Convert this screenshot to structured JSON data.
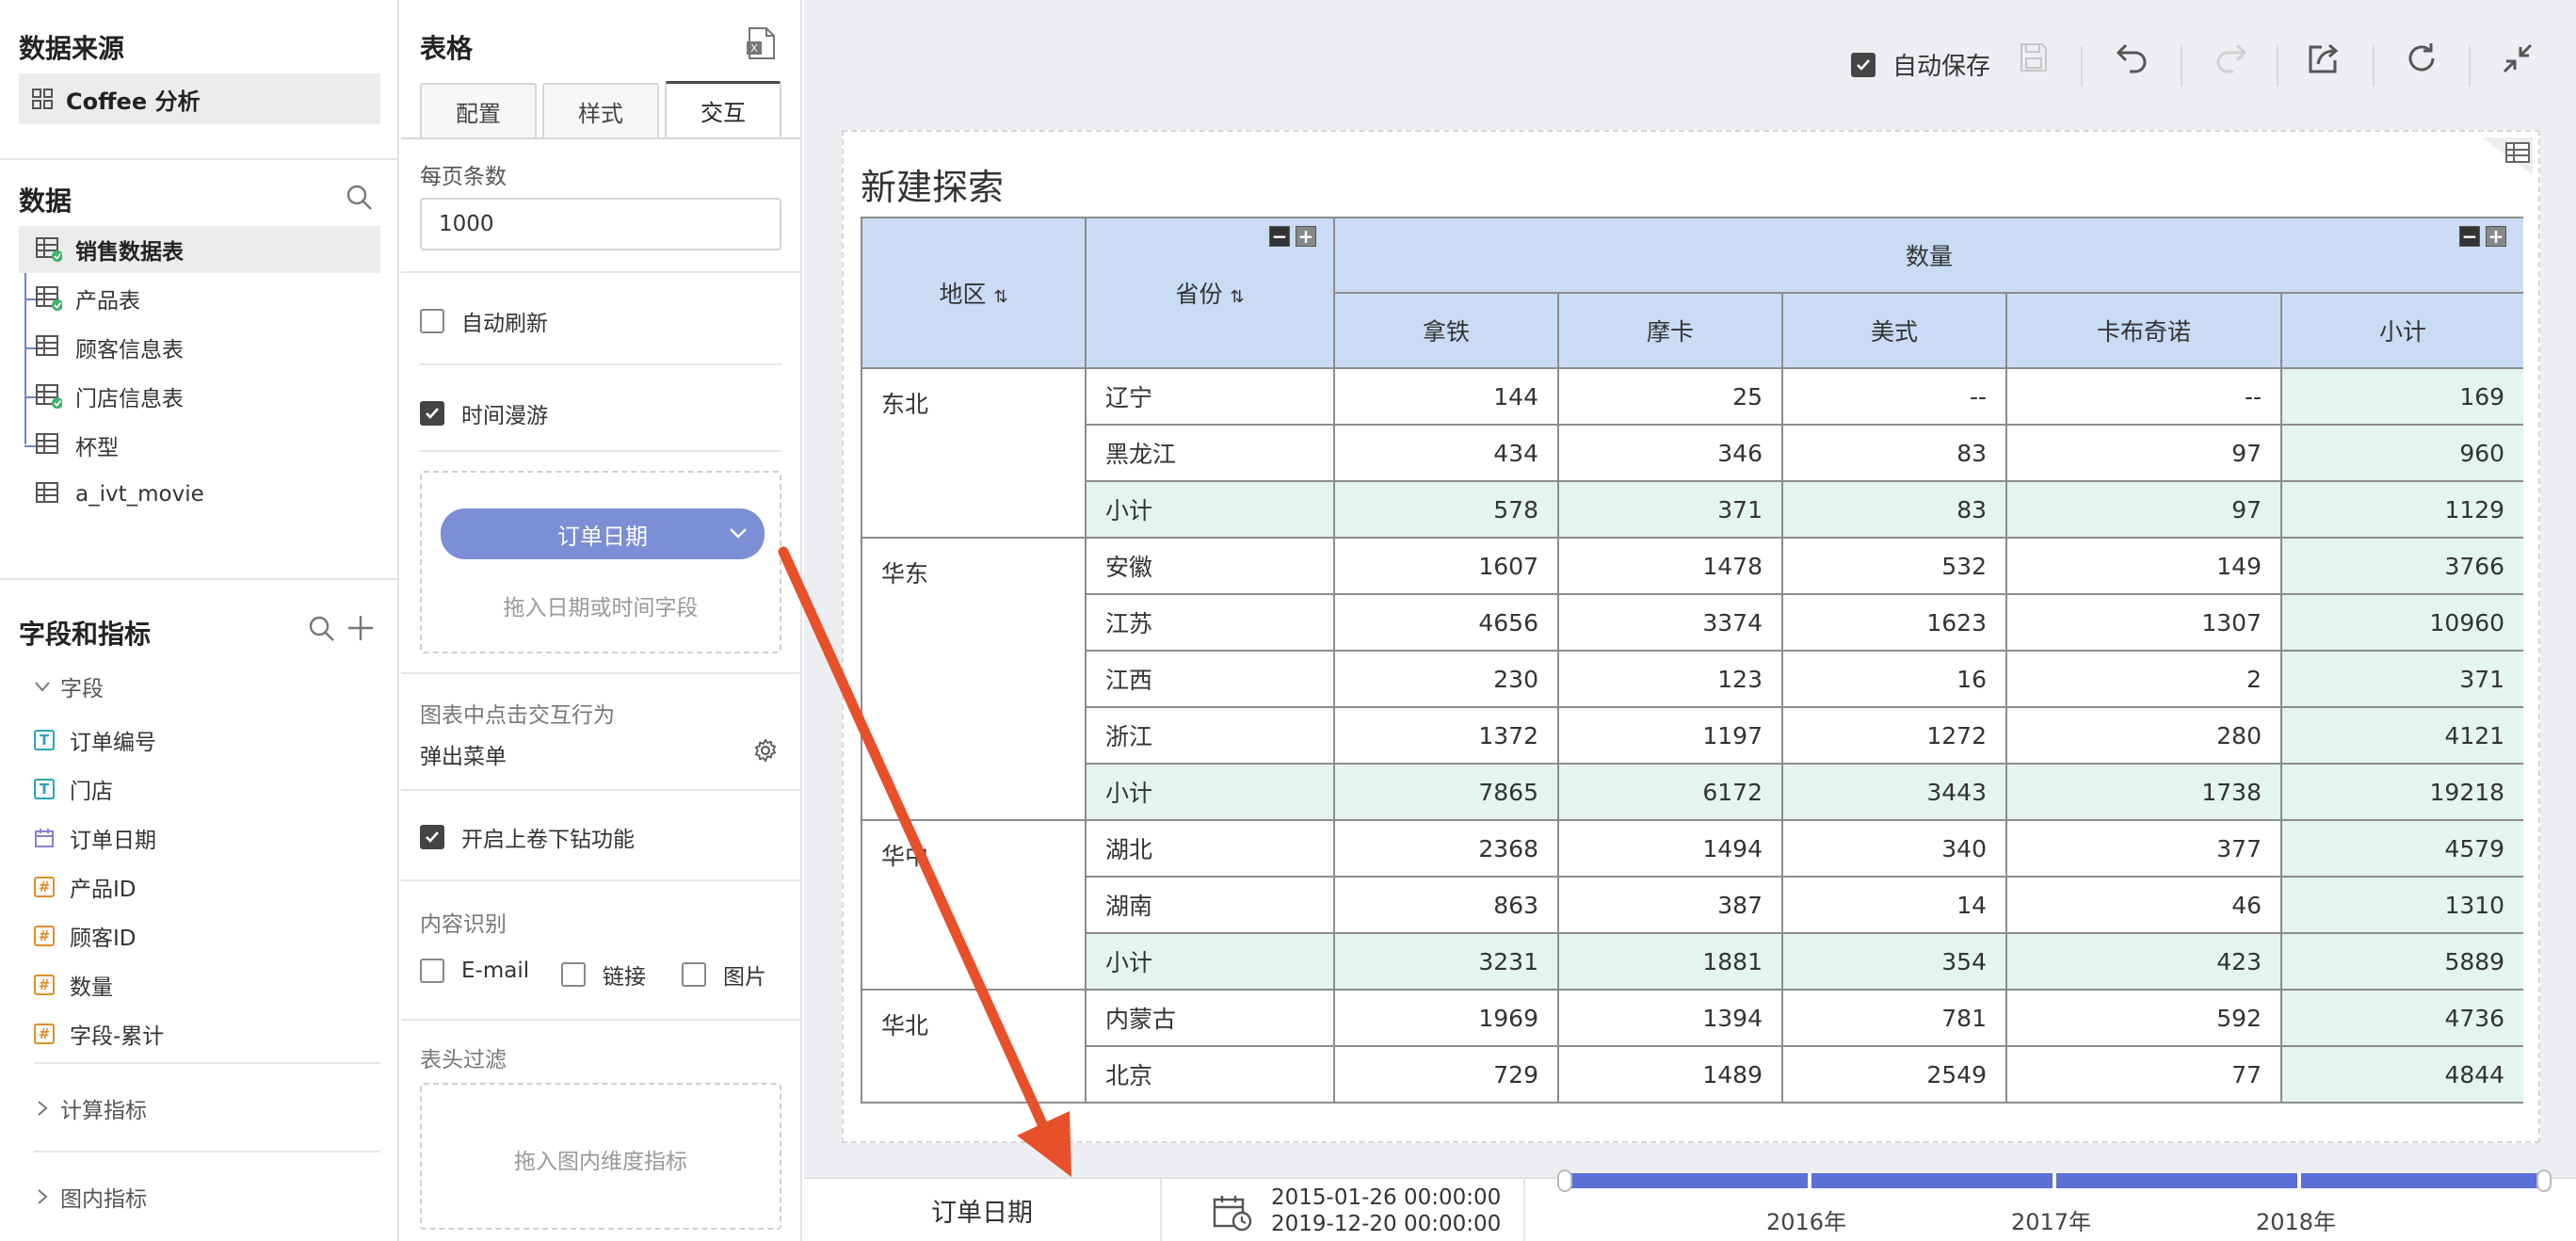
{
  "left": {
    "datasource_title": "数据来源",
    "datasource_name": "Coffee 分析",
    "data_title": "数据",
    "tables": [
      {
        "label": "销售数据表",
        "linked": true,
        "selected": true
      },
      {
        "label": "产品表",
        "linked": true,
        "selected": false
      },
      {
        "label": "顾客信息表",
        "linked": false,
        "selected": false
      },
      {
        "label": "门店信息表",
        "linked": true,
        "selected": false
      },
      {
        "label": "杯型",
        "linked": false,
        "selected": false
      },
      {
        "label": "a_ivt_movie",
        "linked": false,
        "selected": false
      }
    ],
    "fields_title": "字段和指标",
    "fields_group": "字段",
    "fields": [
      {
        "label": "订单编号",
        "type": "text",
        "icon": "T"
      },
      {
        "label": "门店",
        "type": "text",
        "icon": "T"
      },
      {
        "label": "订单日期",
        "type": "date",
        "icon": "calendar"
      },
      {
        "label": "产品ID",
        "type": "number",
        "icon": "#"
      },
      {
        "label": "顾客ID",
        "type": "number",
        "icon": "#"
      },
      {
        "label": "数量",
        "type": "number",
        "icon": "#"
      },
      {
        "label": "字段-累计",
        "type": "number",
        "icon": "#"
      }
    ],
    "calc_group": "计算指标",
    "inner_group": "图内指标"
  },
  "config": {
    "title": "表格",
    "tabs": [
      "配置",
      "样式",
      "交互"
    ],
    "active_tab": "交互",
    "page_size_label": "每页条数",
    "page_size_value": "1000",
    "auto_refresh_label": "自动刷新",
    "auto_refresh_checked": false,
    "time_roam_label": "时间漫游",
    "time_roam_checked": true,
    "date_field": "订单日期",
    "drop_date_hint": "拖入日期或时间字段",
    "click_action_label": "图表中点击交互行为",
    "click_action_value": "弹出菜单",
    "drill_label": "开启上卷下钻功能",
    "drill_checked": true,
    "content_recog_label": "内容识别",
    "recog_email": "E-mail",
    "recog_link": "链接",
    "recog_image": "图片",
    "header_filter_label": "表头过滤",
    "header_filter_hint": "拖入图内维度指标"
  },
  "toolbar": {
    "autosave_label": "自动保存",
    "autosave_checked": true
  },
  "report": {
    "title": "新建探索",
    "col_region": "地区",
    "col_province": "省份",
    "col_group": "数量",
    "measures": [
      "拿铁",
      "摩卡",
      "美式",
      "卡布奇诺",
      "小计"
    ],
    "rows": [
      {
        "region": "东北",
        "province": "辽宁",
        "values": [
          "144",
          "25",
          "--",
          "--",
          "169"
        ],
        "subtotal": false
      },
      {
        "region": "",
        "province": "黑龙江",
        "values": [
          "434",
          "346",
          "83",
          "97",
          "960"
        ],
        "subtotal": false
      },
      {
        "region": "",
        "province": "小计",
        "values": [
          "578",
          "371",
          "83",
          "97",
          "1129"
        ],
        "subtotal": true
      },
      {
        "region": "华东",
        "province": "安徽",
        "values": [
          "1607",
          "1478",
          "532",
          "149",
          "3766"
        ],
        "subtotal": false
      },
      {
        "region": "",
        "province": "江苏",
        "values": [
          "4656",
          "3374",
          "1623",
          "1307",
          "10960"
        ],
        "subtotal": false
      },
      {
        "region": "",
        "province": "江西",
        "values": [
          "230",
          "123",
          "16",
          "2",
          "371"
        ],
        "subtotal": false
      },
      {
        "region": "",
        "province": "浙江",
        "values": [
          "1372",
          "1197",
          "1272",
          "280",
          "4121"
        ],
        "subtotal": false
      },
      {
        "region": "",
        "province": "小计",
        "values": [
          "7865",
          "6172",
          "3443",
          "1738",
          "19218"
        ],
        "subtotal": true
      },
      {
        "region": "华中",
        "province": "湖北",
        "values": [
          "2368",
          "1494",
          "340",
          "377",
          "4579"
        ],
        "subtotal": false
      },
      {
        "region": "",
        "province": "湖南",
        "values": [
          "863",
          "387",
          "14",
          "46",
          "1310"
        ],
        "subtotal": false
      },
      {
        "region": "",
        "province": "小计",
        "values": [
          "3231",
          "1881",
          "354",
          "423",
          "5889"
        ],
        "subtotal": true
      },
      {
        "region": "华北",
        "province": "内蒙古",
        "values": [
          "1969",
          "1394",
          "781",
          "592",
          "4736"
        ],
        "subtotal": false
      },
      {
        "region": "",
        "province": "北京",
        "values": [
          "729",
          "1489",
          "2549",
          "77",
          "4844"
        ],
        "subtotal": false
      }
    ]
  },
  "timebar": {
    "field": "订单日期",
    "start": "2015-01-26 00:00:00",
    "end": "2019-12-20 00:00:00",
    "years": [
      "2016年",
      "2017年",
      "2018年"
    ],
    "accent": "#5b6fd6"
  },
  "annotation": {
    "arrow_color": "#e8502a"
  }
}
